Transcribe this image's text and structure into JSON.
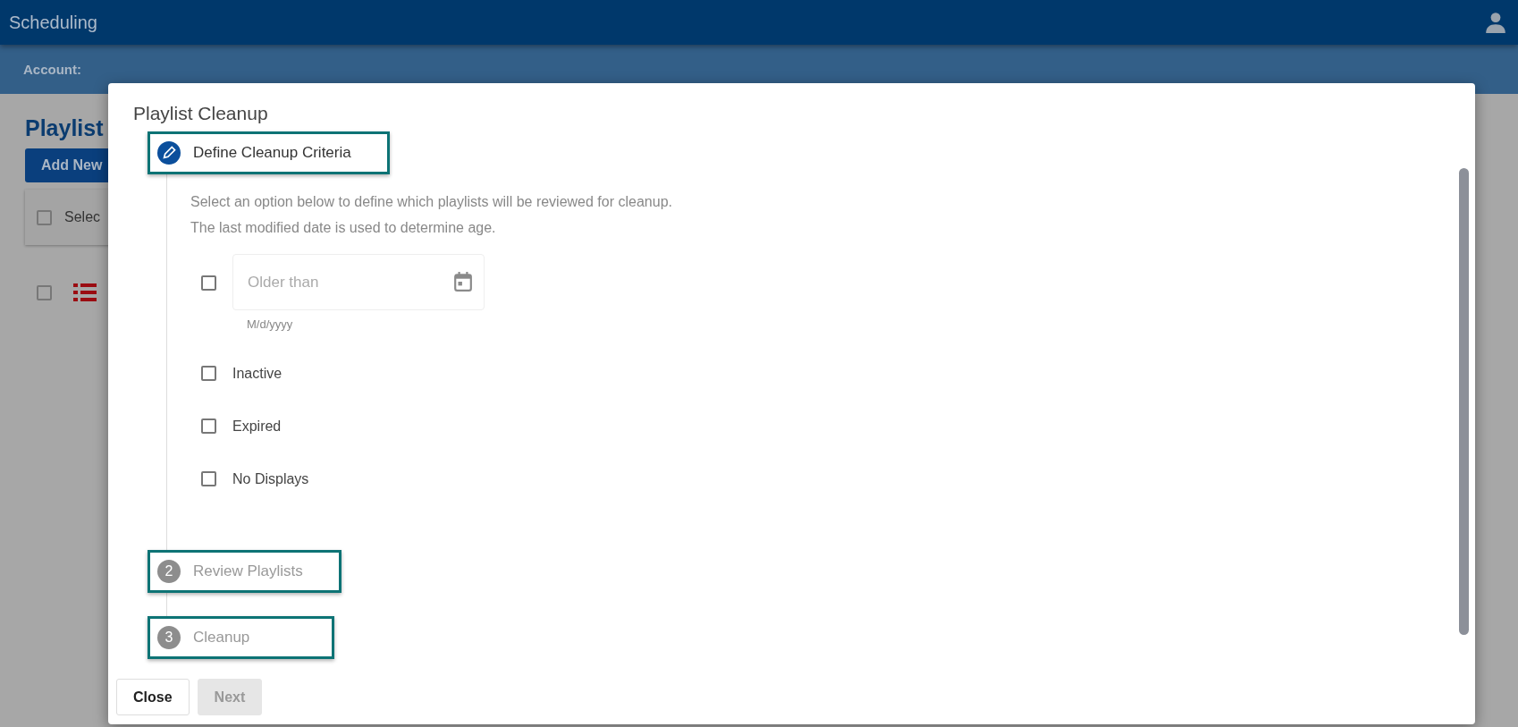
{
  "app": {
    "title": "Scheduling",
    "account_label": "Account:"
  },
  "page": {
    "heading": "Playlist",
    "add_button": "Add New",
    "select_label": "Selec",
    "select_checked": false,
    "row_checked": false
  },
  "dialog": {
    "title": "Playlist Cleanup",
    "steps": [
      {
        "kind": "active",
        "label": "Define Cleanup Criteria",
        "highlighted": true
      },
      {
        "kind": "pending",
        "number": "2",
        "label": "Review Playlists",
        "highlighted": true
      },
      {
        "kind": "pending",
        "number": "3",
        "label": "Cleanup",
        "highlighted": true
      }
    ],
    "description": [
      "Select an option below to define which playlists will be reviewed for cleanup.",
      "The last modified date is used to determine age."
    ],
    "options": [
      {
        "kind": "date",
        "placeholder": "Older than",
        "hint": "M/d/yyyy",
        "checked": false
      },
      {
        "kind": "checkbox",
        "label": "Inactive",
        "checked": false
      },
      {
        "kind": "checkbox",
        "label": "Expired",
        "checked": false
      },
      {
        "kind": "checkbox",
        "label": "No Displays",
        "checked": false
      }
    ],
    "buttons": [
      {
        "label": "Close",
        "disabled": false
      },
      {
        "label": "Next",
        "disabled": true
      }
    ]
  }
}
